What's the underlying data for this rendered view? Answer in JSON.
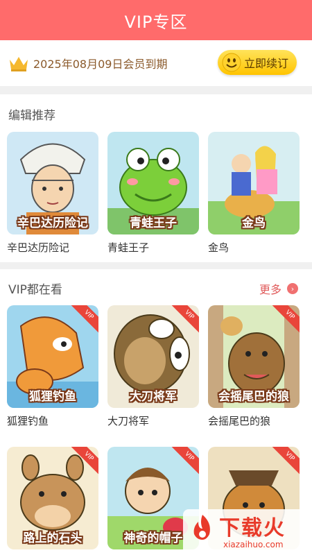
{
  "header": {
    "title": "VIP专区"
  },
  "member": {
    "expire_text": "2025年08月09日会员到期",
    "renew_label": "立即续订"
  },
  "editor_picks": {
    "title": "编辑推荐",
    "items": [
      {
        "cover_title": "辛巴达历险记",
        "caption": "辛巴达历险记"
      },
      {
        "cover_title": "青蛙王子",
        "caption": "青蛙王子"
      },
      {
        "cover_title": "金鸟",
        "caption": "金鸟"
      }
    ]
  },
  "vip_watching": {
    "title": "VIP都在看",
    "more_label": "更多",
    "vip_badge": "VIP",
    "items": [
      {
        "cover_title": "狐狸钓鱼",
        "caption": "狐狸钓鱼"
      },
      {
        "cover_title": "大刀将军",
        "caption": "大刀将军"
      },
      {
        "cover_title": "会摇尾巴的狼",
        "caption": "会摇尾巴的狼"
      },
      {
        "cover_title": "路上的石头",
        "caption": ""
      },
      {
        "cover_title": "神奇的帽子",
        "caption": ""
      },
      {
        "cover_title": "",
        "caption": ""
      }
    ]
  },
  "watermark": {
    "text": "下载火",
    "url": "xiazaihuo.com"
  },
  "colors": {
    "header": "#ff6b6b",
    "accent": "#e05a5a",
    "renew_button": "#ffc400",
    "expire_text": "#8b5a2b"
  }
}
